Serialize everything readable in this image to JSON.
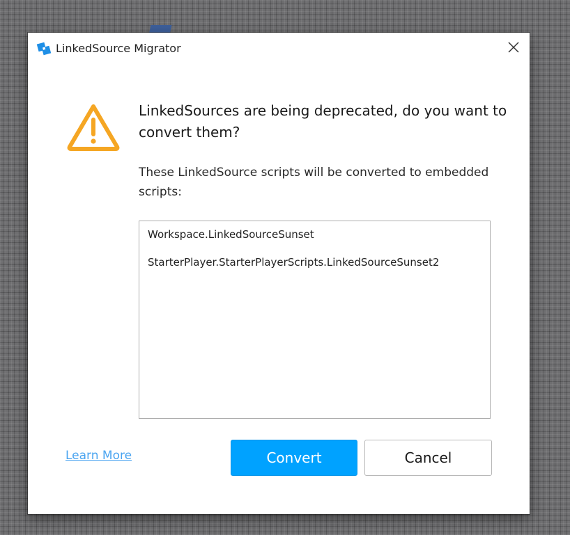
{
  "window": {
    "title": "LinkedSource Migrator",
    "close_icon": "close-icon"
  },
  "dialog": {
    "icon": "warning-icon",
    "headline": "LinkedSources are being deprecated, do you want to convert them?",
    "description": "These LinkedSource scripts will be converted to embedded scripts:",
    "scripts": [
      "Workspace.LinkedSourceSunset",
      "StarterPlayer.StarterPlayerScripts.LinkedSourceSunset2"
    ]
  },
  "footer": {
    "learn_more_label": "Learn More",
    "convert_label": "Convert",
    "cancel_label": "Cancel"
  },
  "colors": {
    "accent": "#00a2ff",
    "link": "#4aa4f0",
    "warning": "#f5a623"
  }
}
